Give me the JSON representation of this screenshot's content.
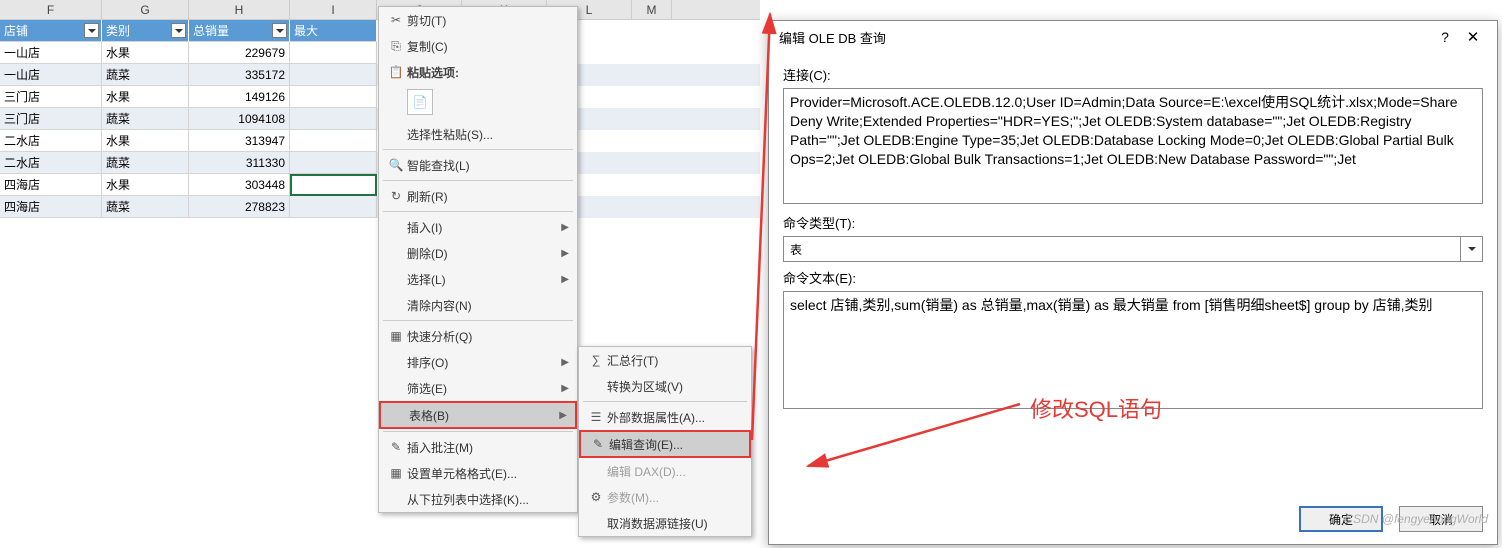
{
  "columns": [
    "F",
    "G",
    "H",
    "I",
    "J",
    "K",
    "L",
    "M"
  ],
  "headers": {
    "f": "店铺",
    "g": "类别",
    "h": "总销量",
    "i": "最大"
  },
  "rows": [
    {
      "f": "一山店",
      "g": "水果",
      "h": "229679"
    },
    {
      "f": "一山店",
      "g": "蔬菜",
      "h": "335172"
    },
    {
      "f": "三门店",
      "g": "水果",
      "h": "149126"
    },
    {
      "f": "三门店",
      "g": "蔬菜",
      "h": "1094108"
    },
    {
      "f": "二水店",
      "g": "水果",
      "h": "313947"
    },
    {
      "f": "二水店",
      "g": "蔬菜",
      "h": "311330"
    },
    {
      "f": "四海店",
      "g": "水果",
      "h": "303448"
    },
    {
      "f": "四海店",
      "g": "蔬菜",
      "h": "278823"
    }
  ],
  "ctx": {
    "cut": "剪切(T)",
    "copy": "复制(C)",
    "paste_opts": "粘贴选项:",
    "paste_special": "选择性粘贴(S)...",
    "smart_lookup": "智能查找(L)",
    "refresh": "刷新(R)",
    "insert": "插入(I)",
    "delete": "删除(D)",
    "select": "选择(L)",
    "clear": "清除内容(N)",
    "quick": "快速分析(Q)",
    "sort": "排序(O)",
    "filter": "筛选(E)",
    "table": "表格(B)",
    "insert_comment": "插入批注(M)",
    "format_cells": "设置单元格格式(E)...",
    "dropdown": "从下拉列表中选择(K)..."
  },
  "sub": {
    "total_row": "汇总行(T)",
    "convert": "转换为区域(V)",
    "ext_data": "外部数据属性(A)...",
    "edit_query": "编辑查询(E)...",
    "edit_dax": "编辑 DAX(D)...",
    "params": "参数(M)...",
    "unlink": "取消数据源链接(U)"
  },
  "dlg": {
    "title": "编辑 OLE DB 查询",
    "connection_label": "连接(C):",
    "connection_text": "Provider=Microsoft.ACE.OLEDB.12.0;User ID=Admin;Data Source=E:\\excel使用SQL统计.xlsx;Mode=Share Deny Write;Extended Properties=\"HDR=YES;\";Jet OLEDB:System database=\"\";Jet OLEDB:Registry Path=\"\";Jet OLEDB:Engine Type=35;Jet OLEDB:Database Locking Mode=0;Jet OLEDB:Global Partial Bulk Ops=2;Jet OLEDB:Global Bulk Transactions=1;Jet OLEDB:New Database Password=\"\";Jet",
    "cmd_type_label": "命令类型(T):",
    "cmd_type_value": "表",
    "cmd_text_label": "命令文本(E):",
    "cmd_text_value": "select 店铺,类别,sum(销量) as 总销量,max(销量) as 最大销量 from [销售明细sheet$] group by 店铺,类别",
    "ok": "确定",
    "cancel": "取消",
    "help": "?",
    "close": "✕"
  },
  "annotation": "修改SQL语句",
  "watermark": "CSDN @fengyehongWorld"
}
